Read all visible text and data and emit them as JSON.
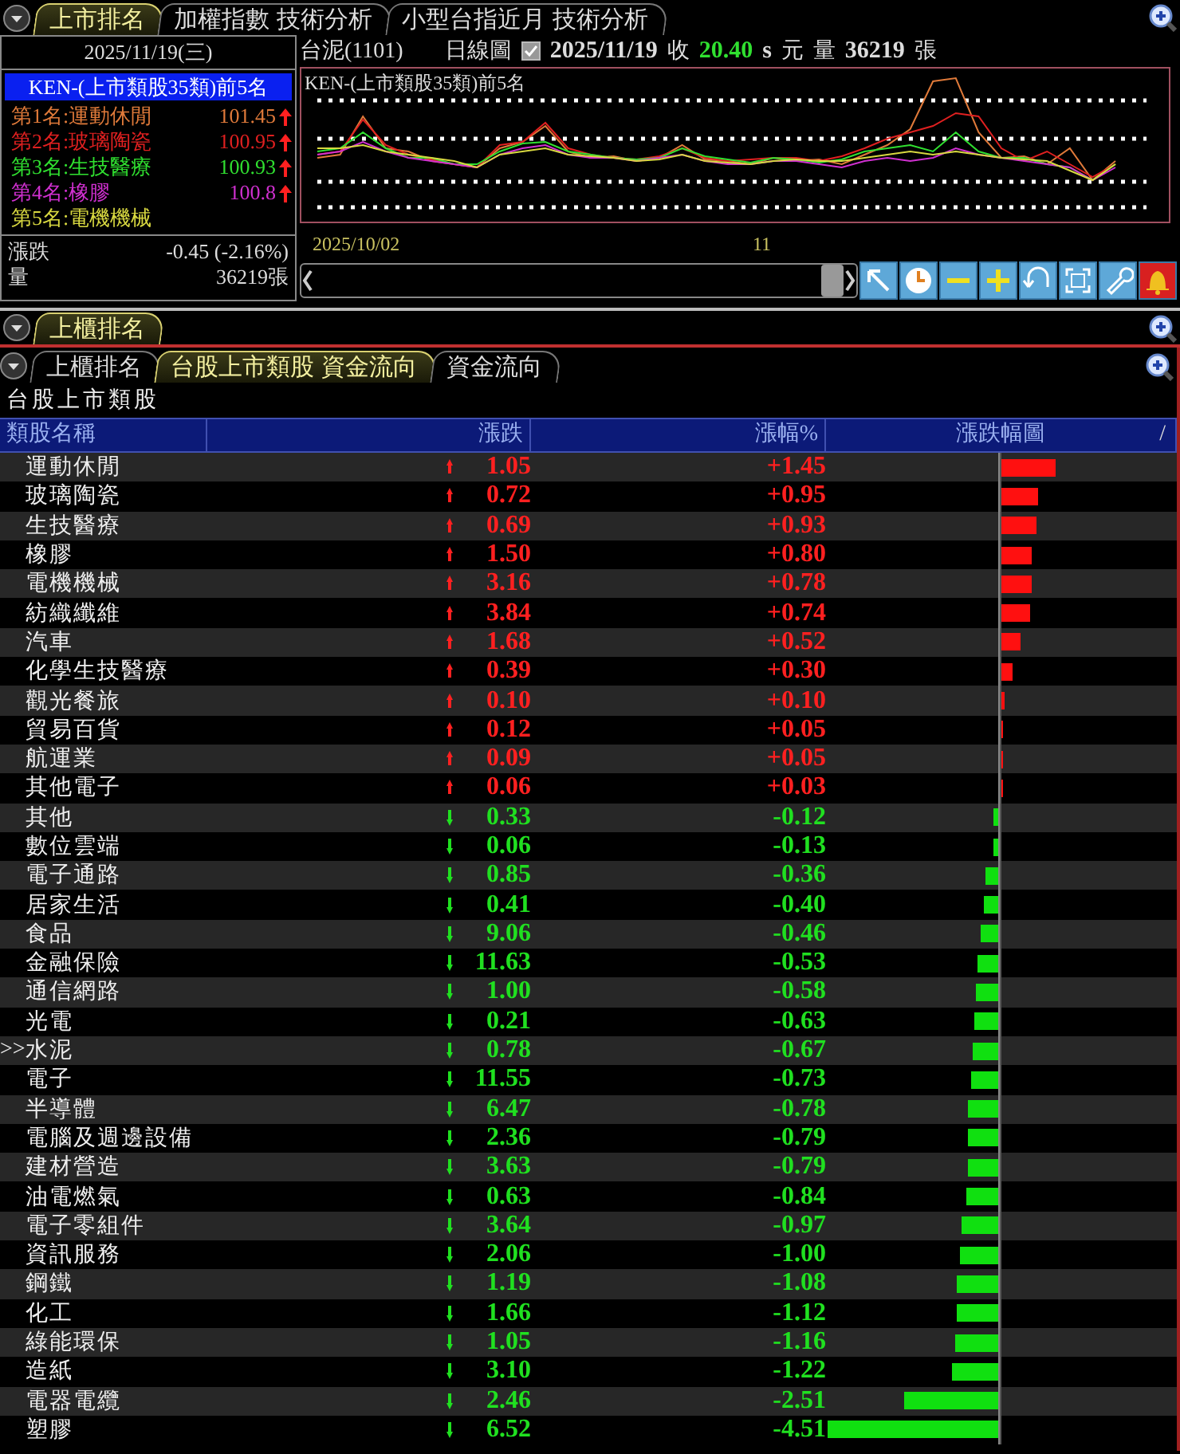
{
  "top_panel": {
    "tabs": [
      {
        "label": "上市排名",
        "selected": true
      },
      {
        "label": "加權指數 技術分析",
        "selected": false
      },
      {
        "label": "小型台指近月 技術分析",
        "selected": false
      }
    ],
    "ranking": {
      "date": "2025/11/19(三)",
      "title": "KEN-(上市類股35類)前5名",
      "items": [
        {
          "label": "第1名:運動休閒",
          "value": "101.45",
          "kind": "up",
          "color": "#e07a3a"
        },
        {
          "label": "第2名:玻璃陶瓷",
          "value": "100.95",
          "kind": "up",
          "color": "#e02020"
        },
        {
          "label": "第3名:生技醫療",
          "value": "100.93",
          "kind": "up",
          "color": "#30e030"
        },
        {
          "label": "第4名:橡膠",
          "value": "100.8",
          "kind": "up",
          "color": "#d030d0"
        },
        {
          "label": "第5名:電機機械",
          "kind": "plain",
          "color": "#d8d840"
        }
      ],
      "change_label": "漲跌",
      "change_value": "-0.45 (-2.16%)",
      "volume_label": "量",
      "volume_value": "36219張"
    },
    "chart": {
      "stock": "台泥(1101)",
      "period": "日線圖",
      "checked": true,
      "date": "2025/11/19",
      "close_label": "收",
      "close": "20.40",
      "unit_s": "s",
      "unit": "元",
      "volume_label": "量",
      "volume": "36219",
      "volume_unit": "張",
      "title": "KEN-(上市類股35類)前5名",
      "x_labels": [
        "2025/10/02",
        "11"
      ]
    }
  },
  "middle_panel": {
    "tabs": [
      {
        "label": "上櫃排名",
        "selected": true
      }
    ]
  },
  "bottom_panel": {
    "tabs": [
      {
        "label": "上櫃排名",
        "selected": false
      },
      {
        "label": "台股上市類股 資金流向",
        "selected": true
      },
      {
        "label": "資金流向",
        "selected": false
      }
    ],
    "title": "台股上市類股",
    "table": {
      "columns": [
        "類股名稱",
        "漲跌",
        "漲幅%",
        "漲跌幅圖"
      ],
      "sort_mark": "/",
      "rows": [
        {
          "name": "運動休閒",
          "kind": "up",
          "change": "1.05",
          "pct": "+1.45",
          "level": 0.315
        },
        {
          "name": "玻璃陶瓷",
          "kind": "up",
          "change": "0.72",
          "pct": "+0.95",
          "level": 0.207
        },
        {
          "name": "生技醫療",
          "kind": "up",
          "change": "0.69",
          "pct": "+0.93",
          "level": 0.202
        },
        {
          "name": "橡膠",
          "kind": "up",
          "change": "1.50",
          "pct": "+0.80",
          "level": 0.174
        },
        {
          "name": "電機機械",
          "kind": "up",
          "change": "3.16",
          "pct": "+0.78",
          "level": 0.17
        },
        {
          "name": "紡織纖維",
          "kind": "up",
          "change": "3.84",
          "pct": "+0.74",
          "level": 0.161
        },
        {
          "name": "汽車",
          "kind": "up",
          "change": "1.68",
          "pct": "+0.52",
          "level": 0.113
        },
        {
          "name": "化學生技醫療",
          "kind": "up",
          "change": "0.39",
          "pct": "+0.30",
          "level": 0.065
        },
        {
          "name": "觀光餐旅",
          "kind": "up",
          "change": "0.10",
          "pct": "+0.10",
          "level": 0.022
        },
        {
          "name": "貿易百貨",
          "kind": "up",
          "change": "0.12",
          "pct": "+0.05",
          "level": 0.011
        },
        {
          "name": "航運業",
          "kind": "up",
          "change": "0.09",
          "pct": "+0.05",
          "level": 0.011
        },
        {
          "name": "其他電子",
          "kind": "up",
          "change": "0.06",
          "pct": "+0.03",
          "level": 0.007
        },
        {
          "name": "其他",
          "kind": "down",
          "change": "0.33",
          "pct": "-0.12",
          "level": 0.026
        },
        {
          "name": "數位雲端",
          "kind": "down",
          "change": "0.06",
          "pct": "-0.13",
          "level": 0.028
        },
        {
          "name": "電子通路",
          "kind": "down",
          "change": "0.85",
          "pct": "-0.36",
          "level": 0.078
        },
        {
          "name": "居家生活",
          "kind": "down",
          "change": "0.41",
          "pct": "-0.40",
          "level": 0.087
        },
        {
          "name": "食品",
          "kind": "down",
          "change": "9.06",
          "pct": "-0.46",
          "level": 0.1
        },
        {
          "name": "金融保險",
          "kind": "down",
          "change": "11.63",
          "pct": "-0.53",
          "level": 0.115
        },
        {
          "name": "通信網路",
          "kind": "down",
          "change": "1.00",
          "pct": "-0.58",
          "level": 0.126
        },
        {
          "name": "光電",
          "kind": "down",
          "change": "0.21",
          "pct": "-0.63",
          "level": 0.137
        },
        {
          "name": "水泥",
          "pointer": ">>",
          "kind": "down",
          "change": "0.78",
          "pct": "-0.67",
          "level": 0.146
        },
        {
          "name": "電子",
          "kind": "down",
          "change": "11.55",
          "pct": "-0.73",
          "level": 0.159
        },
        {
          "name": "半導體",
          "kind": "down",
          "change": "6.47",
          "pct": "-0.78",
          "level": 0.17
        },
        {
          "name": "電腦及週邊設備",
          "kind": "down",
          "change": "2.36",
          "pct": "-0.79",
          "level": 0.172
        },
        {
          "name": "建材營造",
          "kind": "down",
          "change": "3.63",
          "pct": "-0.79",
          "level": 0.172
        },
        {
          "name": "油電燃氣",
          "kind": "down",
          "change": "0.63",
          "pct": "-0.84",
          "level": 0.183
        },
        {
          "name": "電子零組件",
          "kind": "down",
          "change": "3.64",
          "pct": "-0.97",
          "level": 0.211
        },
        {
          "name": "資訊服務",
          "kind": "down",
          "change": "2.06",
          "pct": "-1.00",
          "level": 0.217
        },
        {
          "name": "鋼鐵",
          "kind": "down",
          "change": "1.19",
          "pct": "-1.08",
          "level": 0.235
        },
        {
          "name": "化工",
          "kind": "down",
          "change": "1.66",
          "pct": "-1.12",
          "level": 0.243
        },
        {
          "name": "綠能環保",
          "kind": "down",
          "change": "1.05",
          "pct": "-1.16",
          "level": 0.252
        },
        {
          "name": "造紙",
          "kind": "down",
          "change": "3.10",
          "pct": "-1.22",
          "level": 0.265
        },
        {
          "name": "電器電纜",
          "kind": "down",
          "change": "2.46",
          "pct": "-2.51",
          "level": 0.546
        },
        {
          "name": "塑膠",
          "kind": "down",
          "change": "6.52",
          "pct": "-4.51",
          "level": 0.98
        }
      ]
    }
  }
}
